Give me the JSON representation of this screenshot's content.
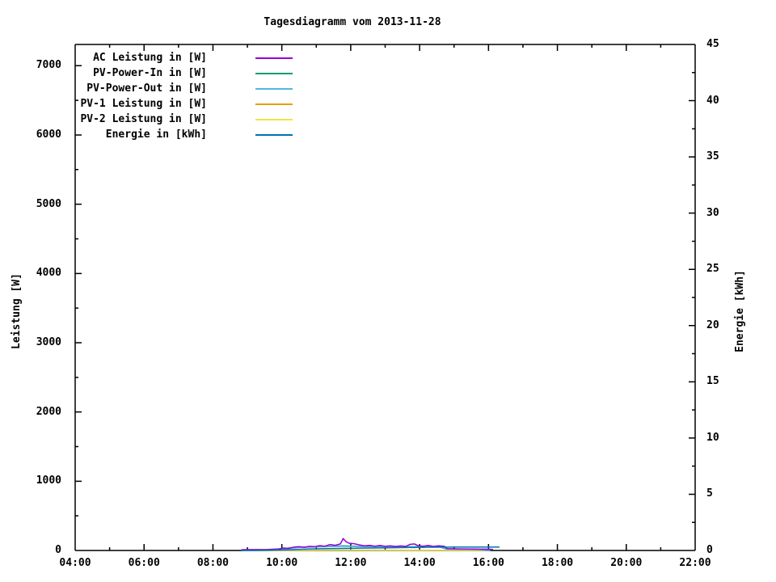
{
  "title": "Tagesdiagramm vom 2013-11-28",
  "axes": {
    "x": {
      "label_format": "HH:MM",
      "major_ticks": [
        4,
        6,
        8,
        10,
        12,
        14,
        16,
        18,
        20,
        22
      ],
      "major_tick_labels": [
        "04:00",
        "06:00",
        "08:00",
        "10:00",
        "12:00",
        "14:00",
        "16:00",
        "18:00",
        "20:00",
        "22:00"
      ],
      "minor_ticks": [
        5,
        7,
        9,
        11,
        13,
        15,
        17,
        19,
        21
      ],
      "range_hours": [
        4,
        22
      ]
    },
    "y_left": {
      "title": "Leistung [W]",
      "major_ticks": [
        0,
        1000,
        2000,
        3000,
        4000,
        5000,
        6000,
        7000
      ],
      "minor_step": 500,
      "range": [
        0,
        7307
      ]
    },
    "y_right": {
      "title": "Energie [kWh]",
      "major_ticks": [
        0,
        5,
        10,
        15,
        20,
        25,
        30,
        35,
        40,
        45
      ],
      "minor_step": 2.5,
      "range": [
        0,
        45
      ]
    }
  },
  "legend": {
    "position": "top-left-inside",
    "entries": [
      {
        "label": "AC Leistung in [W]",
        "color": "#9400d3"
      },
      {
        "label": "PV-Power-In in [W]",
        "color": "#009e73"
      },
      {
        "label": "PV-Power-Out in [W]",
        "color": "#56b4e9"
      },
      {
        "label": "PV-1 Leistung in [W]",
        "color": "#e69f00"
      },
      {
        "label": "PV-2 Leistung in [W]",
        "color": "#f0e442"
      },
      {
        "label": "Energie in [kWh]",
        "color": "#0072b2"
      }
    ]
  },
  "chart_data": {
    "type": "line",
    "title": "Tagesdiagramm vom 2013-11-28",
    "xlabel_units": "time of day (hours)",
    "x_range": [
      4,
      22
    ],
    "y_left_label": "Leistung [W]",
    "y_left_range": [
      0,
      7307
    ],
    "y_right_label": "Energie [kWh]",
    "y_right_range": [
      0,
      45
    ],
    "grid": false,
    "legend_position": "top-left",
    "series": [
      {
        "name": "PV-1 Leistung in [W]",
        "color": "#e69f00",
        "axis": "left",
        "points": [
          [
            9.0,
            3
          ],
          [
            10.5,
            5
          ],
          [
            12.0,
            6
          ],
          [
            13.5,
            5
          ],
          [
            14.8,
            4
          ],
          [
            16.0,
            2
          ]
        ]
      },
      {
        "name": "PV-2 Leistung in [W]",
        "color": "#f0e442",
        "axis": "left",
        "points": [
          [
            9.0,
            2
          ],
          [
            10.5,
            4
          ],
          [
            12.0,
            5
          ],
          [
            13.5,
            4
          ],
          [
            14.8,
            3
          ],
          [
            16.0,
            2
          ]
        ]
      },
      {
        "name": "PV-Power-In in [W]",
        "color": "#009e73",
        "axis": "left",
        "points": [
          [
            9.85,
            18
          ],
          [
            10.3,
            40
          ],
          [
            10.6,
            50
          ],
          [
            11.0,
            55
          ],
          [
            11.4,
            60
          ],
          [
            11.8,
            66
          ],
          [
            12.2,
            60
          ],
          [
            12.6,
            57
          ],
          [
            13.0,
            55
          ],
          [
            13.4,
            52
          ],
          [
            13.8,
            56
          ],
          [
            14.2,
            54
          ],
          [
            14.6,
            52
          ],
          [
            14.75,
            24
          ],
          [
            15.2,
            21
          ],
          [
            15.7,
            19
          ],
          [
            16.07,
            19
          ],
          [
            16.07,
            0
          ]
        ]
      },
      {
        "name": "PV-Power-Out in [W]",
        "color": "#56b4e9",
        "axis": "left",
        "points": [
          [
            9.9,
            15
          ],
          [
            10.3,
            35
          ],
          [
            10.6,
            45
          ],
          [
            11.0,
            50
          ],
          [
            11.4,
            55
          ],
          [
            11.8,
            60
          ],
          [
            12.2,
            55
          ],
          [
            12.6,
            52
          ],
          [
            13.0,
            50
          ],
          [
            13.4,
            48
          ],
          [
            13.8,
            52
          ],
          [
            14.2,
            50
          ],
          [
            14.6,
            48
          ],
          [
            14.75,
            20
          ],
          [
            15.2,
            18
          ],
          [
            15.7,
            16
          ],
          [
            16.05,
            0
          ]
        ]
      },
      {
        "name": "AC Leistung in [W]",
        "color": "#9400d3",
        "axis": "left",
        "points": [
          [
            8.83,
            12
          ],
          [
            9.2,
            13
          ],
          [
            9.6,
            15
          ],
          [
            9.9,
            22
          ],
          [
            10.05,
            35
          ],
          [
            10.2,
            30
          ],
          [
            10.35,
            48
          ],
          [
            10.5,
            55
          ],
          [
            10.65,
            45
          ],
          [
            10.8,
            60
          ],
          [
            10.95,
            55
          ],
          [
            11.1,
            70
          ],
          [
            11.25,
            62
          ],
          [
            11.4,
            85
          ],
          [
            11.55,
            75
          ],
          [
            11.7,
            95
          ],
          [
            11.78,
            170
          ],
          [
            11.87,
            125
          ],
          [
            11.95,
            105
          ],
          [
            12.1,
            98
          ],
          [
            12.25,
            80
          ],
          [
            12.4,
            68
          ],
          [
            12.55,
            75
          ],
          [
            12.7,
            62
          ],
          [
            12.85,
            72
          ],
          [
            13.0,
            60
          ],
          [
            13.15,
            68
          ],
          [
            13.3,
            58
          ],
          [
            13.45,
            65
          ],
          [
            13.6,
            60
          ],
          [
            13.72,
            88
          ],
          [
            13.85,
            95
          ],
          [
            13.95,
            70
          ],
          [
            14.1,
            62
          ],
          [
            14.25,
            72
          ],
          [
            14.4,
            58
          ],
          [
            14.55,
            68
          ],
          [
            14.72,
            60
          ],
          [
            14.8,
            24
          ],
          [
            15.1,
            22
          ],
          [
            15.5,
            20
          ],
          [
            15.8,
            18
          ],
          [
            16.13,
            14
          ]
        ]
      },
      {
        "name": "Energie in [kWh]",
        "color": "#0072b2",
        "axis": "right",
        "points": [
          [
            8.83,
            0.01
          ],
          [
            9.5,
            0.03
          ],
          [
            10.2,
            0.07
          ],
          [
            10.75,
            0.13
          ],
          [
            10.8,
            0.14
          ],
          [
            11.5,
            0.17
          ],
          [
            12.15,
            0.2
          ],
          [
            12.2,
            0.21
          ],
          [
            13.0,
            0.24
          ],
          [
            14.15,
            0.28
          ],
          [
            14.2,
            0.29
          ],
          [
            15.0,
            0.3
          ],
          [
            16.32,
            0.3
          ]
        ]
      }
    ]
  }
}
